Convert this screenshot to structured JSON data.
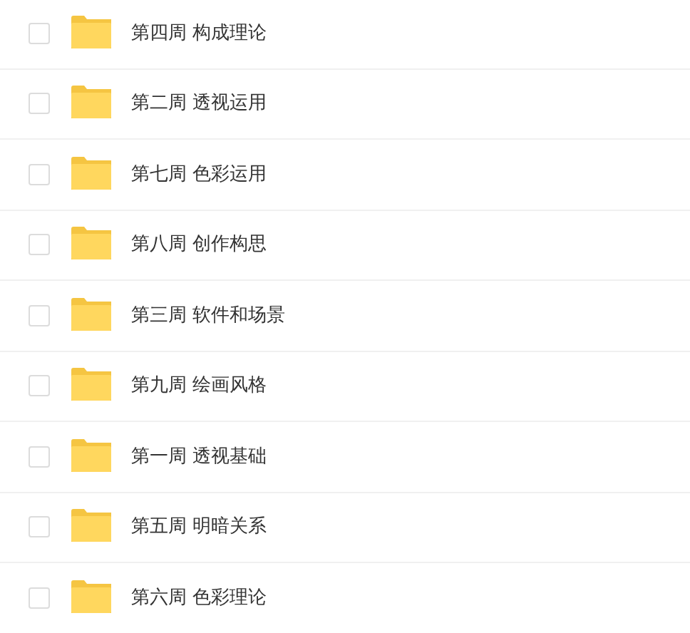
{
  "folders": [
    {
      "name": "第四周 构成理论",
      "checked": false
    },
    {
      "name": "第二周 透视运用",
      "checked": false
    },
    {
      "name": "第七周 色彩运用",
      "checked": false
    },
    {
      "name": "第八周 创作构思",
      "checked": false
    },
    {
      "name": "第三周 软件和场景",
      "checked": false
    },
    {
      "name": "第九周 绘画风格",
      "checked": false
    },
    {
      "name": "第一周 透视基础",
      "checked": false
    },
    {
      "name": "第五周 明暗关系",
      "checked": false
    },
    {
      "name": "第六周 色彩理论",
      "checked": false
    }
  ]
}
